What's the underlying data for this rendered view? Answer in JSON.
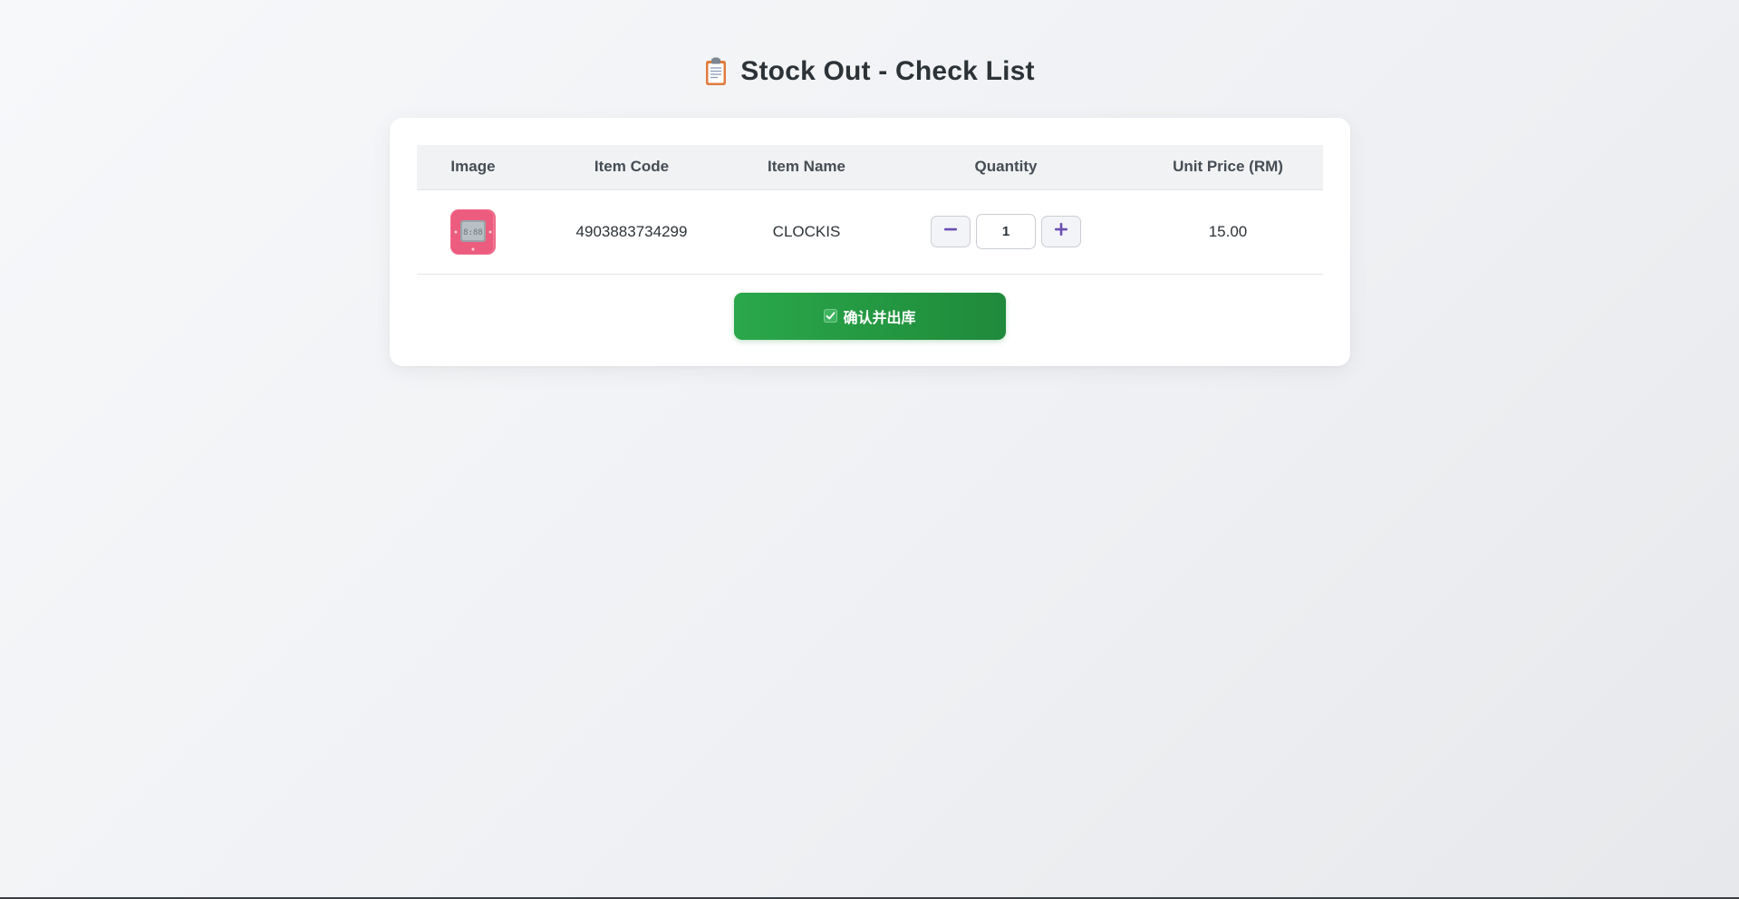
{
  "page": {
    "title": "Stock Out - Check List",
    "title_icon": "clipboard-icon"
  },
  "table": {
    "headers": {
      "image": "Image",
      "item_code": "Item Code",
      "item_name": "Item Name",
      "quantity": "Quantity",
      "unit_price": "Unit Price (RM)"
    },
    "rows": [
      {
        "image": "pink-clock-thumbnail",
        "item_code": "4903883734299",
        "item_name": "CLOCKIS",
        "quantity": "1",
        "unit_price": "15.00"
      }
    ]
  },
  "controls": {
    "decrement_icon": "minus-icon",
    "increment_icon": "plus-icon",
    "confirm_label": "确认并出库",
    "confirm_icon": "check-box-icon"
  },
  "colors": {
    "accent_green": "#2aa84a",
    "stepper_purple": "#6b4fb3",
    "title": "#2c3338"
  }
}
